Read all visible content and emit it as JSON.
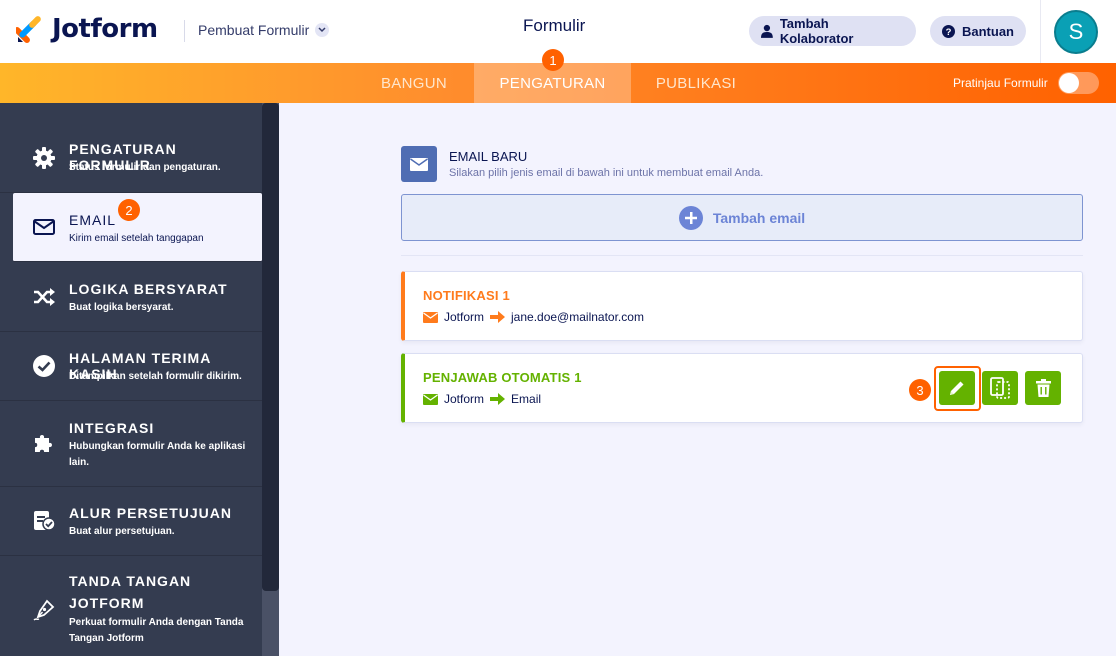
{
  "header": {
    "logo_text": "Jotform",
    "builder_label": "Pembuat Formulir",
    "title": "Formulir",
    "collaborator_label": "Tambah Kolaborator",
    "help_label": "Bantuan",
    "avatar_initial": "S"
  },
  "nav": {
    "tabs": [
      {
        "label": "BANGUN",
        "active": false
      },
      {
        "label": "PENGATURAN",
        "active": true
      },
      {
        "label": "PUBLIKASI",
        "active": false
      }
    ],
    "preview_label": "Pratinjau Formulir",
    "preview_enabled": false
  },
  "badges": [
    "1",
    "2",
    "3"
  ],
  "sidebar": {
    "items": [
      {
        "icon": "gear-icon",
        "title": "PENGATURAN FORMULIR",
        "desc": "Status formulir dan pengaturan."
      },
      {
        "icon": "envelope-icon",
        "title": "EMAIL",
        "desc": "Kirim email setelah tanggapan",
        "active": true
      },
      {
        "icon": "shuffle-icon",
        "title": "LOGIKA BERSYARAT",
        "desc": "Buat logika bersyarat."
      },
      {
        "icon": "check-circle-icon",
        "title": "HALAMAN TERIMA KASIH",
        "desc": "Ditampilkan setelah formulir dikirim."
      },
      {
        "icon": "puzzle-icon",
        "title": "INTEGRASI",
        "desc1": "Hubungkan formulir Anda ke aplikasi",
        "desc2": "lain."
      },
      {
        "icon": "approval-icon",
        "title": "ALUR PERSETUJUAN",
        "desc": "Buat alur persetujuan."
      },
      {
        "icon": "pen-nib-icon",
        "title1": "TANDA TANGAN",
        "title2": "JOTFORM",
        "desc1": "Perkuat formulir Anda dengan Tanda",
        "desc2": "Tangan Jotform"
      }
    ]
  },
  "main": {
    "new_email_title": "EMAIL BARU",
    "new_email_sub": "Silakan pilih jenis email di bawah ini untuk membuat email Anda.",
    "add_email_label": "Tambah email",
    "cards": [
      {
        "title": "NOTIFIKASI 1",
        "from": "Jotform",
        "to": "jane.doe@mailnator.com",
        "accent": "#ff7b1c"
      },
      {
        "title": "PENJAWAB OTOMATIS 1",
        "from": "Jotform",
        "to": "Email",
        "accent": "#64b200"
      }
    ]
  },
  "colors": {
    "navy": "#0a1551",
    "orange": "#ff6100",
    "green": "#64b200",
    "sidebar": "#343c50",
    "main_bg": "#f3f3fe"
  }
}
